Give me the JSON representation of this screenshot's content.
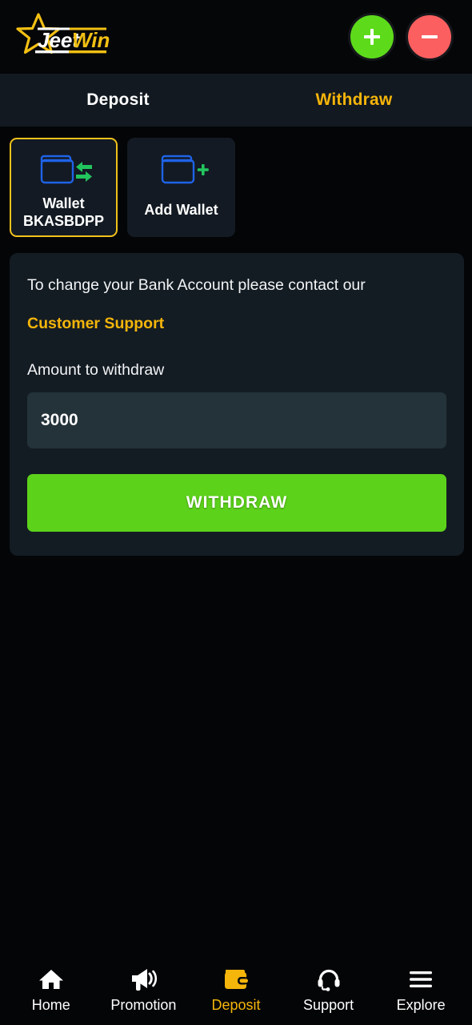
{
  "header": {
    "logo": {
      "name": "jeetwin-logo",
      "text_light": "Jeet",
      "text_accent": "Win",
      "star_color": "#f3c013",
      "accent_color": "#f3c013"
    },
    "actions": [
      {
        "name": "add-balance-button",
        "icon": "plus-icon",
        "label": "+",
        "color": "#5ddb1b"
      },
      {
        "name": "withdraw-balance-button",
        "icon": "minus-icon",
        "label": "−",
        "color": "#fb5f5f"
      }
    ]
  },
  "tabs": [
    {
      "label": "Deposit",
      "active": false
    },
    {
      "label": "Withdraw",
      "active": true
    }
  ],
  "wallets": [
    {
      "name": "wallet-card-bkasbdpp",
      "line1": "Wallet",
      "line2": "BKASBDPP",
      "icon": "wallet-transfer-icon",
      "selected": true
    },
    {
      "name": "wallet-card-add",
      "line1": "Add Wallet",
      "line2": "",
      "icon": "wallet-add-icon",
      "selected": false
    }
  ],
  "panel": {
    "note": "To change your Bank Account please contact our",
    "support_link": "Customer Support",
    "amount_label": "Amount to withdraw",
    "amount_value": "3000",
    "amount_placeholder": "Amount to withdraw",
    "submit_label": "WITHDRAW",
    "submit_color": "#5cd21a"
  },
  "bottom_nav": [
    {
      "label": "Home",
      "icon": "home-icon",
      "active": false
    },
    {
      "label": "Promotion",
      "icon": "megaphone-icon",
      "active": false
    },
    {
      "label": "Deposit",
      "icon": "wallet-icon",
      "active": true
    },
    {
      "label": "Support",
      "icon": "headset-icon",
      "active": false
    },
    {
      "label": "Explore",
      "icon": "hamburger-menu-icon",
      "active": false
    }
  ],
  "colors": {
    "page_bg": "#040507",
    "panel_bg": "#141c23",
    "tabbar_bg": "#121920",
    "input_bg": "#24333a",
    "accent_gold": "#f5b50a",
    "accent_green": "#5cd21a",
    "icon_blue": "#1f63e8",
    "icon_green": "#22c55e"
  }
}
